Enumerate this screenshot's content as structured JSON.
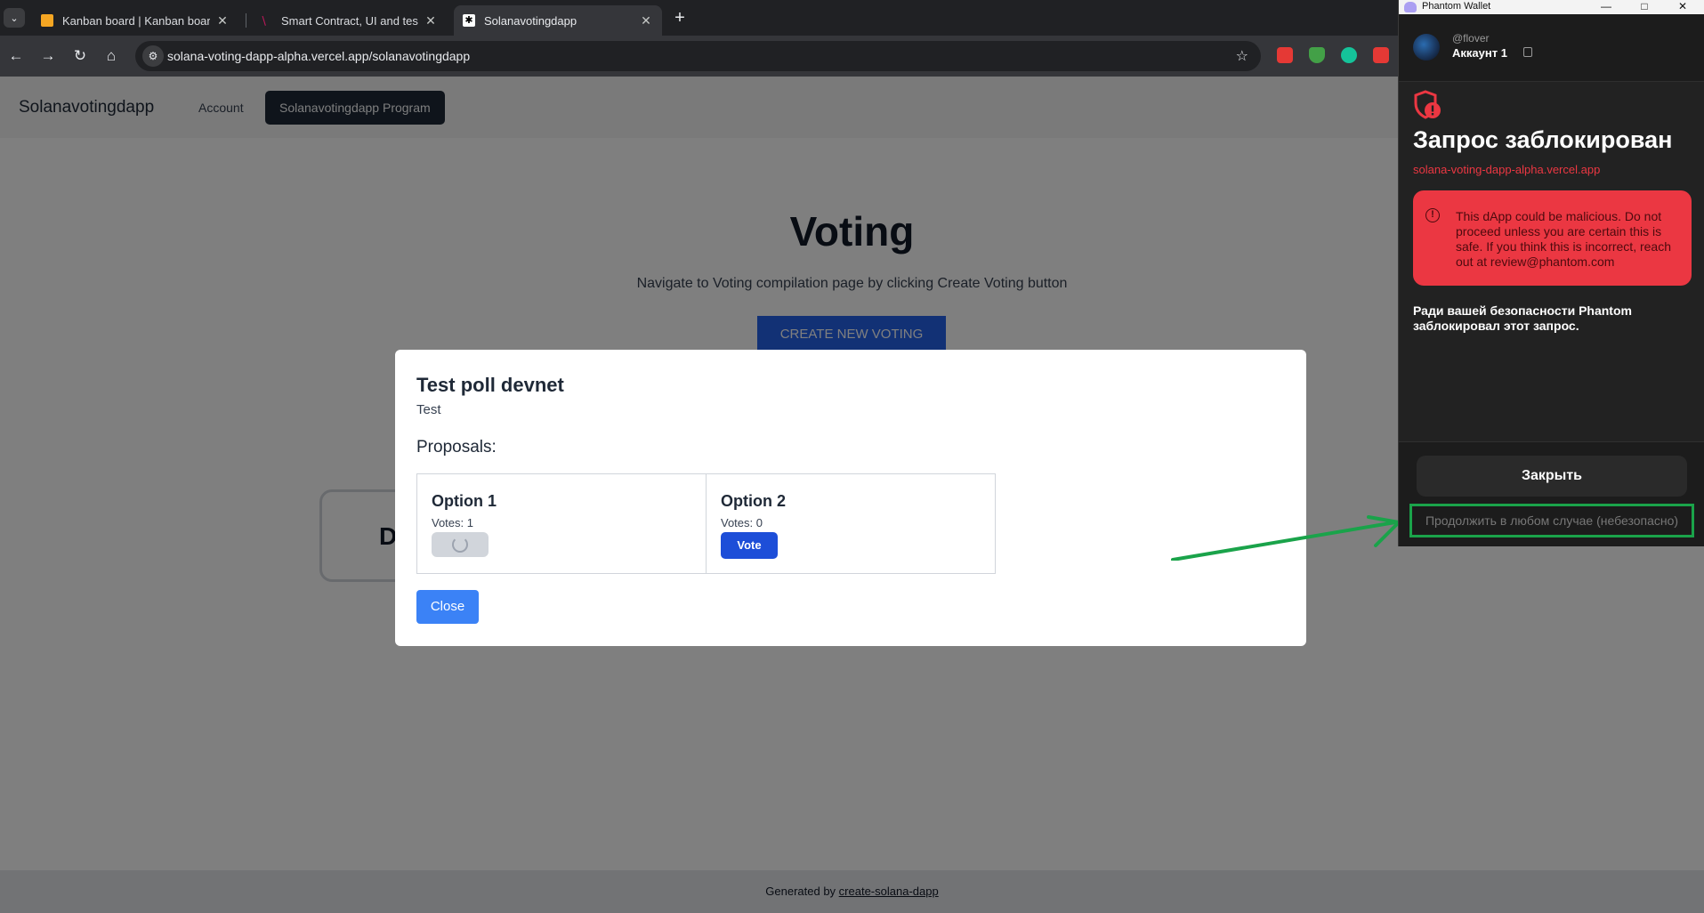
{
  "browser": {
    "tabs": [
      {
        "label": "Kanban board | Kanban board",
        "favicon_color": "#f5a623"
      },
      {
        "label": "Smart Contract, UI and tests ch",
        "favicon_color": "#c2185b"
      },
      {
        "label": "Solanavotingdapp",
        "favicon_color": "#ffffff"
      }
    ],
    "url": "solana-voting-dapp-alpha.vercel.app/solanavotingdapp"
  },
  "app": {
    "brand": "Solanavotingdapp",
    "nav": {
      "account": "Account",
      "program": "Solanavotingdapp Program"
    },
    "hero": {
      "title": "Voting",
      "subtitle": "Navigate to Voting compilation page by clicking Create Voting button",
      "create_button": "CREATE NEW VOTING"
    },
    "background_card_letter": "D",
    "footer": {
      "prefix": "Generated by ",
      "link": "create-solana-dapp"
    }
  },
  "modal": {
    "title": "Test poll devnet",
    "description": "Test",
    "proposals_label": "Proposals:",
    "options": [
      {
        "name": "Option 1",
        "votes": "Votes: 1",
        "state": "loading"
      },
      {
        "name": "Option 2",
        "votes": "Votes: 0",
        "state": "idle",
        "vote_label": "Vote"
      }
    ],
    "close_label": "Close"
  },
  "phantom": {
    "window_title": "Phantom Wallet",
    "handle": "@flover",
    "account": "Аккаунт 1",
    "heading": "Запрос заблокирован",
    "domain": "solana-voting-dapp-alpha.vercel.app",
    "warning": "This dApp could be malicious. Do not proceed unless you are certain this is safe. If you think this is incorrect, reach out at review@phantom.com",
    "note": "Ради вашей безопасности Phantom заблокировал этот запрос.",
    "close_label": "Закрыть",
    "continue_label": "Продолжить в любом случае (небезопасно)",
    "danger_color": "#eb3742",
    "highlight_color": "#1aa34a"
  }
}
